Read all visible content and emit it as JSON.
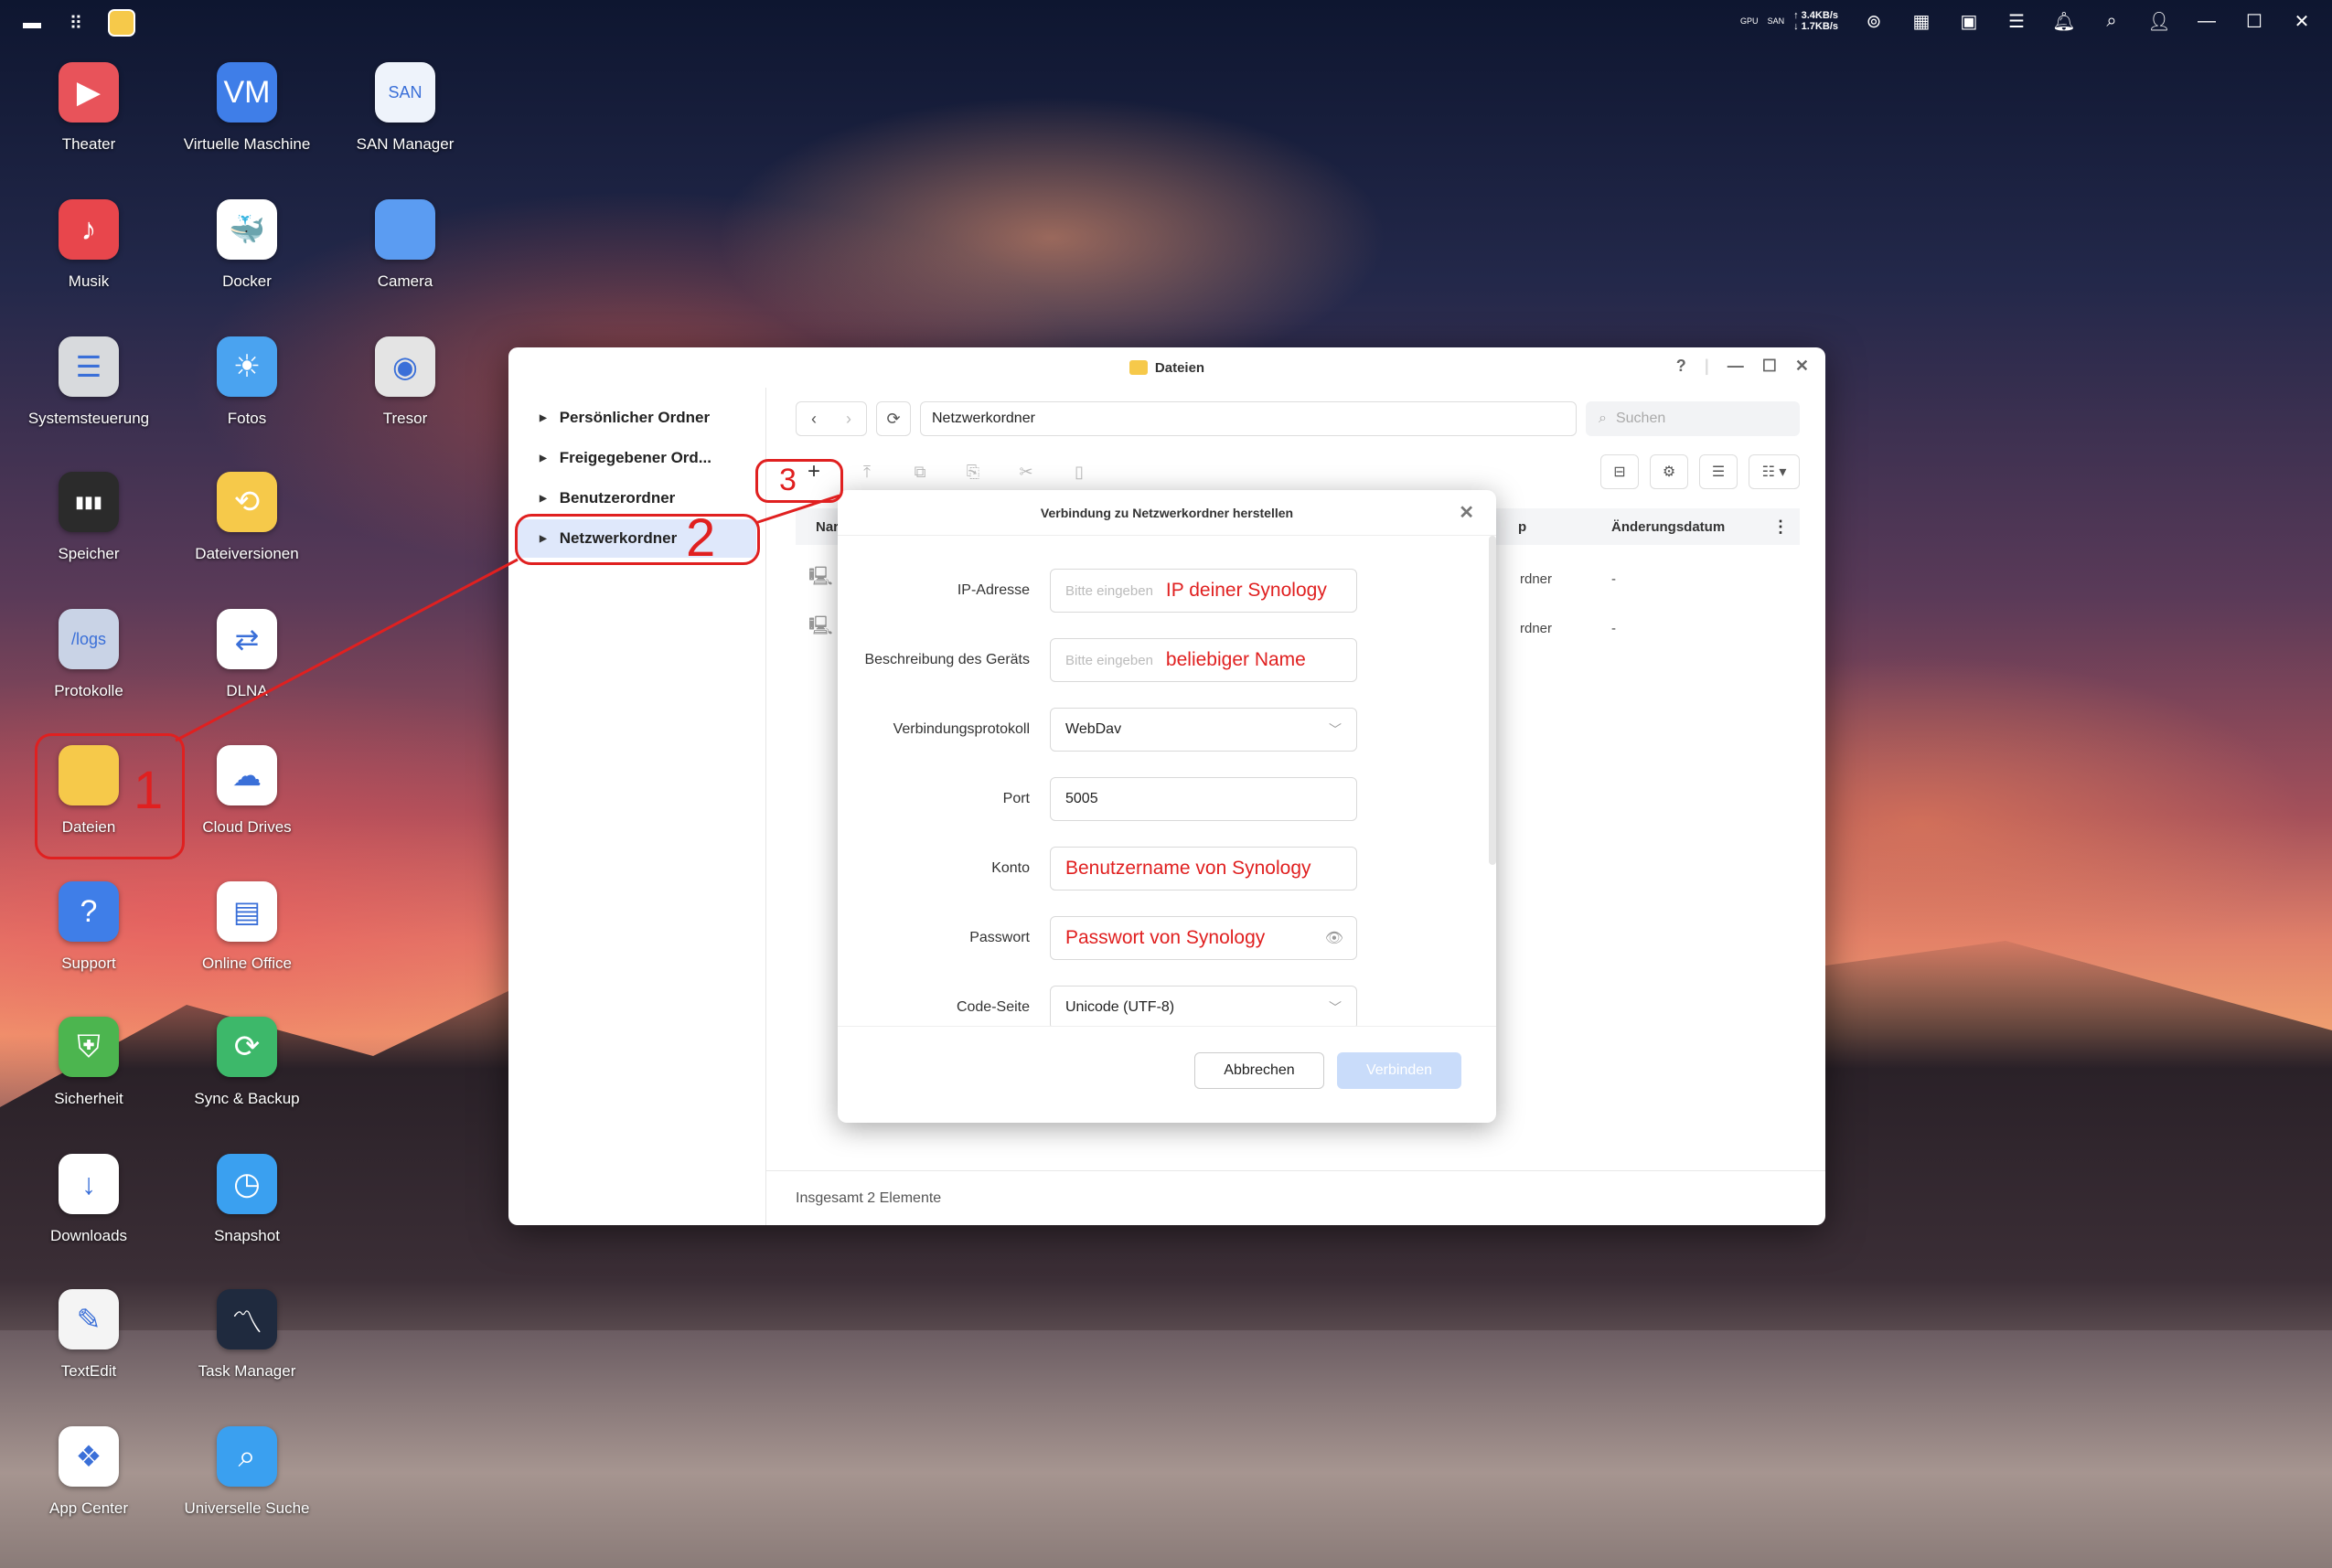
{
  "topbar": {
    "upload_speed": "↑ 3.4KB/s",
    "download_speed": "↓ 1.7KB/s",
    "gpu_label": "GPU",
    "san_label": "SAN"
  },
  "desktop": {
    "icons": [
      {
        "label": "Theater",
        "color": "#e8535a",
        "glyph": "▶"
      },
      {
        "label": "Virtuelle Maschine",
        "color": "#3f7ee8",
        "glyph": "VM"
      },
      {
        "label": "SAN Manager",
        "color": "#eef3fb",
        "glyph": "SAN"
      },
      {
        "label": "Musik",
        "color": "#e8464c",
        "glyph": "♪"
      },
      {
        "label": "Docker",
        "color": "#ffffff",
        "glyph": "🐳"
      },
      {
        "label": "Camera",
        "color": "#5b9cf2",
        "glyph": ""
      },
      {
        "label": "Systemsteuerung",
        "color": "#d8dadd",
        "glyph": "☰"
      },
      {
        "label": "Fotos",
        "color": "#4aa3f0",
        "glyph": "☀"
      },
      {
        "label": "Tresor",
        "color": "#e4e4e4",
        "glyph": "◉"
      },
      {
        "label": "Speicher",
        "color": "#2b2b2b",
        "glyph": "▮▮▮"
      },
      {
        "label": "Dateiversionen",
        "color": "#f6c94a",
        "glyph": "⟲"
      },
      {
        "label": "Protokolle",
        "color": "#c9d3e6",
        "glyph": "/logs"
      },
      {
        "label": "DLNA",
        "color": "#ffffff",
        "glyph": "⇄"
      },
      {
        "label": "Dateien",
        "color": "#f6c94a",
        "glyph": ""
      },
      {
        "label": "Cloud Drives",
        "color": "#ffffff",
        "glyph": "☁"
      },
      {
        "label": "Support",
        "color": "#3f7ee8",
        "glyph": "?"
      },
      {
        "label": "Online Office",
        "color": "#ffffff",
        "glyph": "▤"
      },
      {
        "label": "Sicherheit",
        "color": "#4cb54f",
        "glyph": "⛨"
      },
      {
        "label": "Sync & Backup",
        "color": "#3db86a",
        "glyph": "⟳"
      },
      {
        "label": "Downloads",
        "color": "#ffffff",
        "glyph": "↓"
      },
      {
        "label": "Snapshot",
        "color": "#3aa0f0",
        "glyph": "◷"
      },
      {
        "label": "TextEdit",
        "color": "#f4f4f4",
        "glyph": "✎"
      },
      {
        "label": "Task Manager",
        "color": "#1f2a3e",
        "glyph": "〽"
      },
      {
        "label": "App Center",
        "color": "#ffffff",
        "glyph": "❖"
      },
      {
        "label": "Universelle Suche",
        "color": "#3aa0f0",
        "glyph": "⌕"
      }
    ]
  },
  "window": {
    "title": "Dateien",
    "sidebar": [
      "Persönlicher Ordner",
      "Freigegebener Ord...",
      "Benutzerordner",
      "Netzwerkordner"
    ],
    "path": "Netzwerkordner",
    "search_placeholder": "Suchen",
    "columns": {
      "name": "Nar",
      "type": "p",
      "date": "Änderungsdatum"
    },
    "rows": [
      {
        "type": "rdner",
        "date": "-"
      },
      {
        "type": "rdner",
        "date": "-"
      }
    ],
    "footer": "Insgesamt 2 Elemente"
  },
  "dialog": {
    "title": "Verbindung zu Netzwerkordner herstellen",
    "fields": [
      {
        "label": "IP-Adresse",
        "placeholder": "Bitte eingeben",
        "annotation": "IP deiner Synology"
      },
      {
        "label": "Beschreibung des Geräts",
        "placeholder": "Bitte eingeben",
        "annotation": "beliebiger Name"
      },
      {
        "label": "Verbindungsprotokoll",
        "value": "WebDav"
      },
      {
        "label": "Port",
        "value": "5005"
      },
      {
        "label": "Konto",
        "annotation": "Benutzername von Synology"
      },
      {
        "label": "Passwort",
        "annotation": "Passwort von Synology"
      },
      {
        "label": "Code-Seite",
        "value": "Unicode (UTF-8)"
      }
    ],
    "cancel": "Abbrechen",
    "connect": "Verbinden"
  },
  "annotations": {
    "step1": "1",
    "step2": "2",
    "step3": "3"
  }
}
